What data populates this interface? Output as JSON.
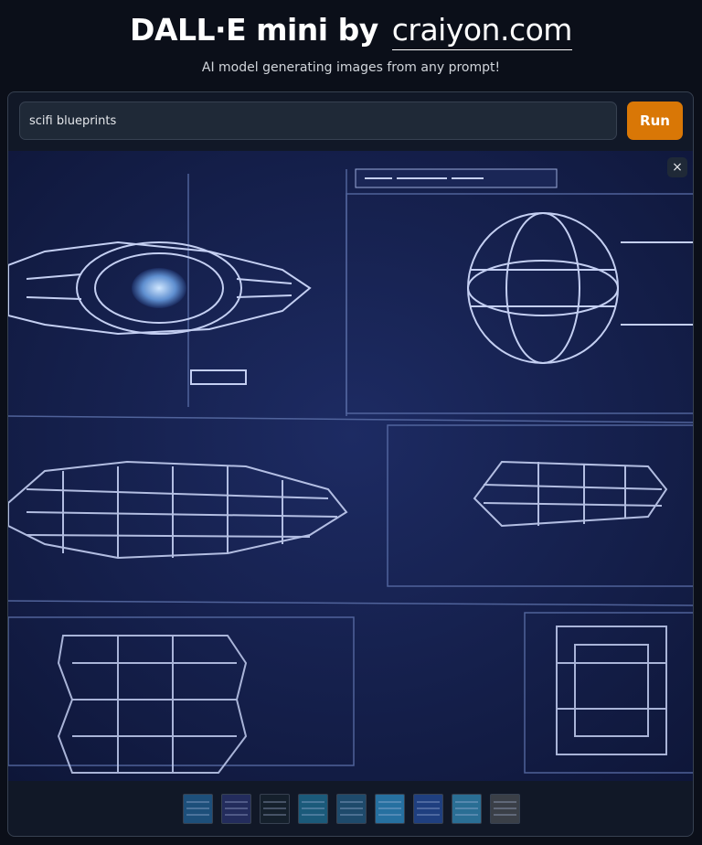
{
  "header": {
    "title": "DALL·E mini by",
    "link": "craiyon.com",
    "subtitle": "AI model generating images from any prompt!"
  },
  "prompt": {
    "value": "scifi blueprints"
  },
  "run_label": "Run",
  "close_symbol": "×",
  "viewer": {
    "image_name": "scifi-blueprint-image"
  },
  "thumbnails": [
    {
      "name": "thumb-1",
      "color": "#1d4f7a"
    },
    {
      "name": "thumb-2",
      "color": "#232c5c"
    },
    {
      "name": "thumb-3",
      "color": "#15202c"
    },
    {
      "name": "thumb-4",
      "color": "#1b5a7a"
    },
    {
      "name": "thumb-5",
      "color": "#1e4a6b"
    },
    {
      "name": "thumb-6",
      "color": "#2670a0"
    },
    {
      "name": "thumb-7",
      "color": "#1f3f7f"
    },
    {
      "name": "thumb-8",
      "color": "#2a6e94"
    },
    {
      "name": "thumb-9",
      "color": "#3a3f47"
    }
  ]
}
